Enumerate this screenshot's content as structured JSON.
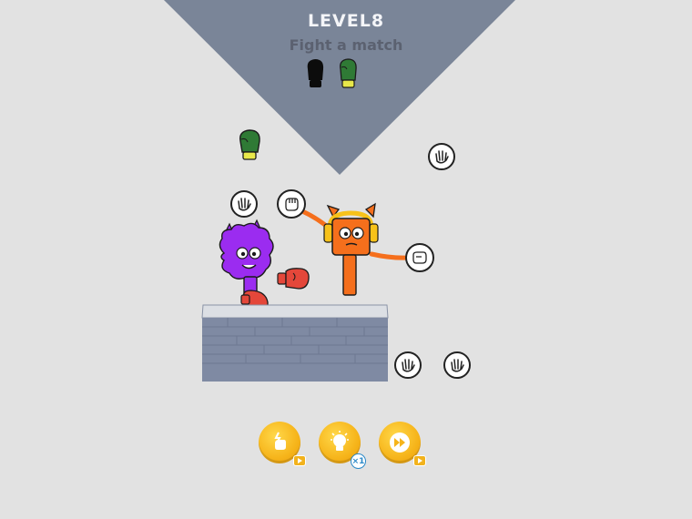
{
  "hud": {
    "level_label": "LEVEL8",
    "objective": "Fight a match"
  },
  "colors": {
    "background": "#e2e2e2",
    "banner": "#7a8598",
    "purple_character": "#9b2cf0",
    "orange_character": "#f56f1c",
    "glove_red": "#e4473a",
    "glove_green": "#2f7a35",
    "platform": "#7f8aa3",
    "button_gold": "#f6b41a"
  },
  "objective_progress": {
    "gloves_total": 2,
    "gloves_collected": 1
  },
  "buttons": [
    {
      "name": "power-button",
      "icon": "lightning-fist-icon",
      "badge": "video-ad-icon"
    },
    {
      "name": "hint-button",
      "icon": "lightbulb-icon",
      "badge_text": "x1"
    },
    {
      "name": "skip-button",
      "icon": "fast-forward-icon",
      "badge": "video-ad-icon"
    }
  ]
}
